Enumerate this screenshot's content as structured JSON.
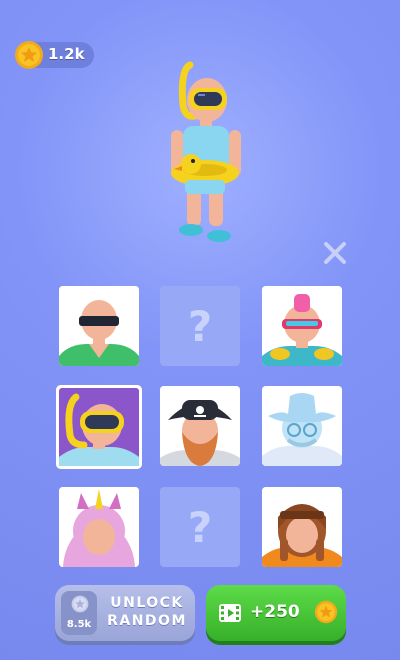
{
  "currency": {
    "amount": "1.2k",
    "icon": "star-coin-icon"
  },
  "character_preview": {
    "description": "character with snorkel mask and duck float ring"
  },
  "close_button": {
    "icon": "close-icon"
  },
  "grid": {
    "cells": [
      {
        "name": "sunglasses-skin",
        "state": "owned"
      },
      {
        "name": "unknown-skin-1",
        "state": "locked",
        "glyph": "?"
      },
      {
        "name": "punk-visor-skin",
        "state": "owned"
      },
      {
        "name": "snorkel-skin",
        "state": "selected"
      },
      {
        "name": "pirate-skin",
        "state": "owned"
      },
      {
        "name": "ghost-cowboy-skin",
        "state": "owned"
      },
      {
        "name": "unicorn-hood-skin",
        "state": "owned"
      },
      {
        "name": "unknown-skin-2",
        "state": "locked",
        "glyph": "?"
      },
      {
        "name": "aviator-skin",
        "state": "owned"
      }
    ]
  },
  "unlock_random": {
    "price": "8.5k",
    "line1": "UNLOCK",
    "line2": "RANDOM"
  },
  "watch_ad": {
    "reward": "+250",
    "icon": "video-icon"
  },
  "colors": {
    "background": "#8294f7",
    "green": "#37b02a",
    "gray_button": "#9aa5d8",
    "coin": "#f7c325"
  }
}
